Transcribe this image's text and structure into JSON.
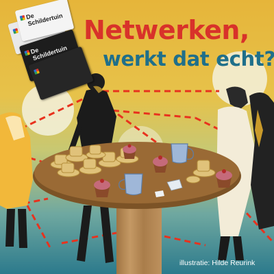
{
  "title": "Netwerken,",
  "subtitle": "werkt dat echt?",
  "credit": "illustratie: Hilde Reurink",
  "cards": {
    "brand_line1": "De",
    "brand_line2": "Schildertuin"
  },
  "colors": {
    "title": "#d8322a",
    "subtitle": "#1f6f8a",
    "table": "#9a6a35",
    "background_top": "#e6b53a",
    "background_bottom": "#2c7a8c",
    "network_lines": "#e8321e"
  }
}
